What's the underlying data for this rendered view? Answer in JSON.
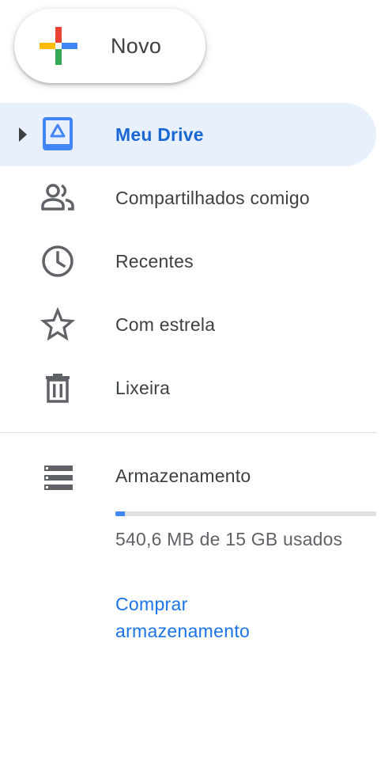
{
  "new_button": {
    "label": "Novo",
    "icon": "plus-icon"
  },
  "nav": {
    "items": [
      {
        "label": "Meu Drive",
        "icon": "drive-icon",
        "active": true
      },
      {
        "label": "Compartilhados comigo",
        "icon": "people-icon",
        "active": false
      },
      {
        "label": "Recentes",
        "icon": "clock-icon",
        "active": false
      },
      {
        "label": "Com estrela",
        "icon": "star-icon",
        "active": false
      },
      {
        "label": "Lixeira",
        "icon": "trash-icon",
        "active": false
      }
    ]
  },
  "storage": {
    "label": "Armazenamento",
    "icon": "storage-icon",
    "used_fraction": 0.036,
    "usage_text": "540,6 MB de 15 GB usados",
    "buy_label": "Comprar armazenamento"
  },
  "colors": {
    "accent": "#1967d2",
    "active_bg": "#e8f0fe",
    "link": "#1a73e8",
    "icon": "#5f6368",
    "storage_fill": "#4285f4"
  }
}
